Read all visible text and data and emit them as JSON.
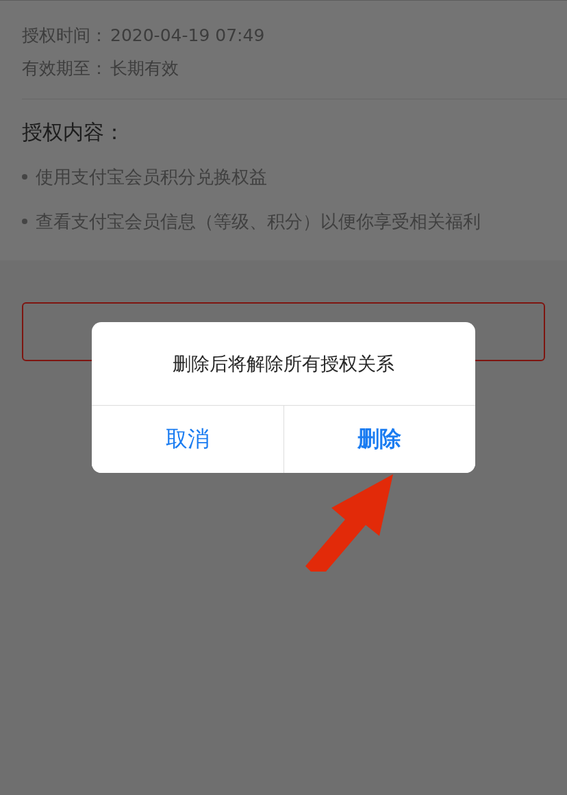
{
  "details": [
    {
      "label": "授权时间：",
      "value": "2020-04-19 07:49"
    },
    {
      "label": "有效期至：",
      "value": "长期有效"
    }
  ],
  "section": {
    "title": "授权内容：",
    "items": [
      "使用支付宝会员积分兑换权益",
      "查看支付宝会员信息（等级、积分）以便你享受相关福利"
    ]
  },
  "dialog": {
    "message": "删除后将解除所有授权关系",
    "buttons": [
      {
        "label": "取消",
        "kind": "cancel"
      },
      {
        "label": "删除",
        "kind": "destructive"
      }
    ]
  }
}
